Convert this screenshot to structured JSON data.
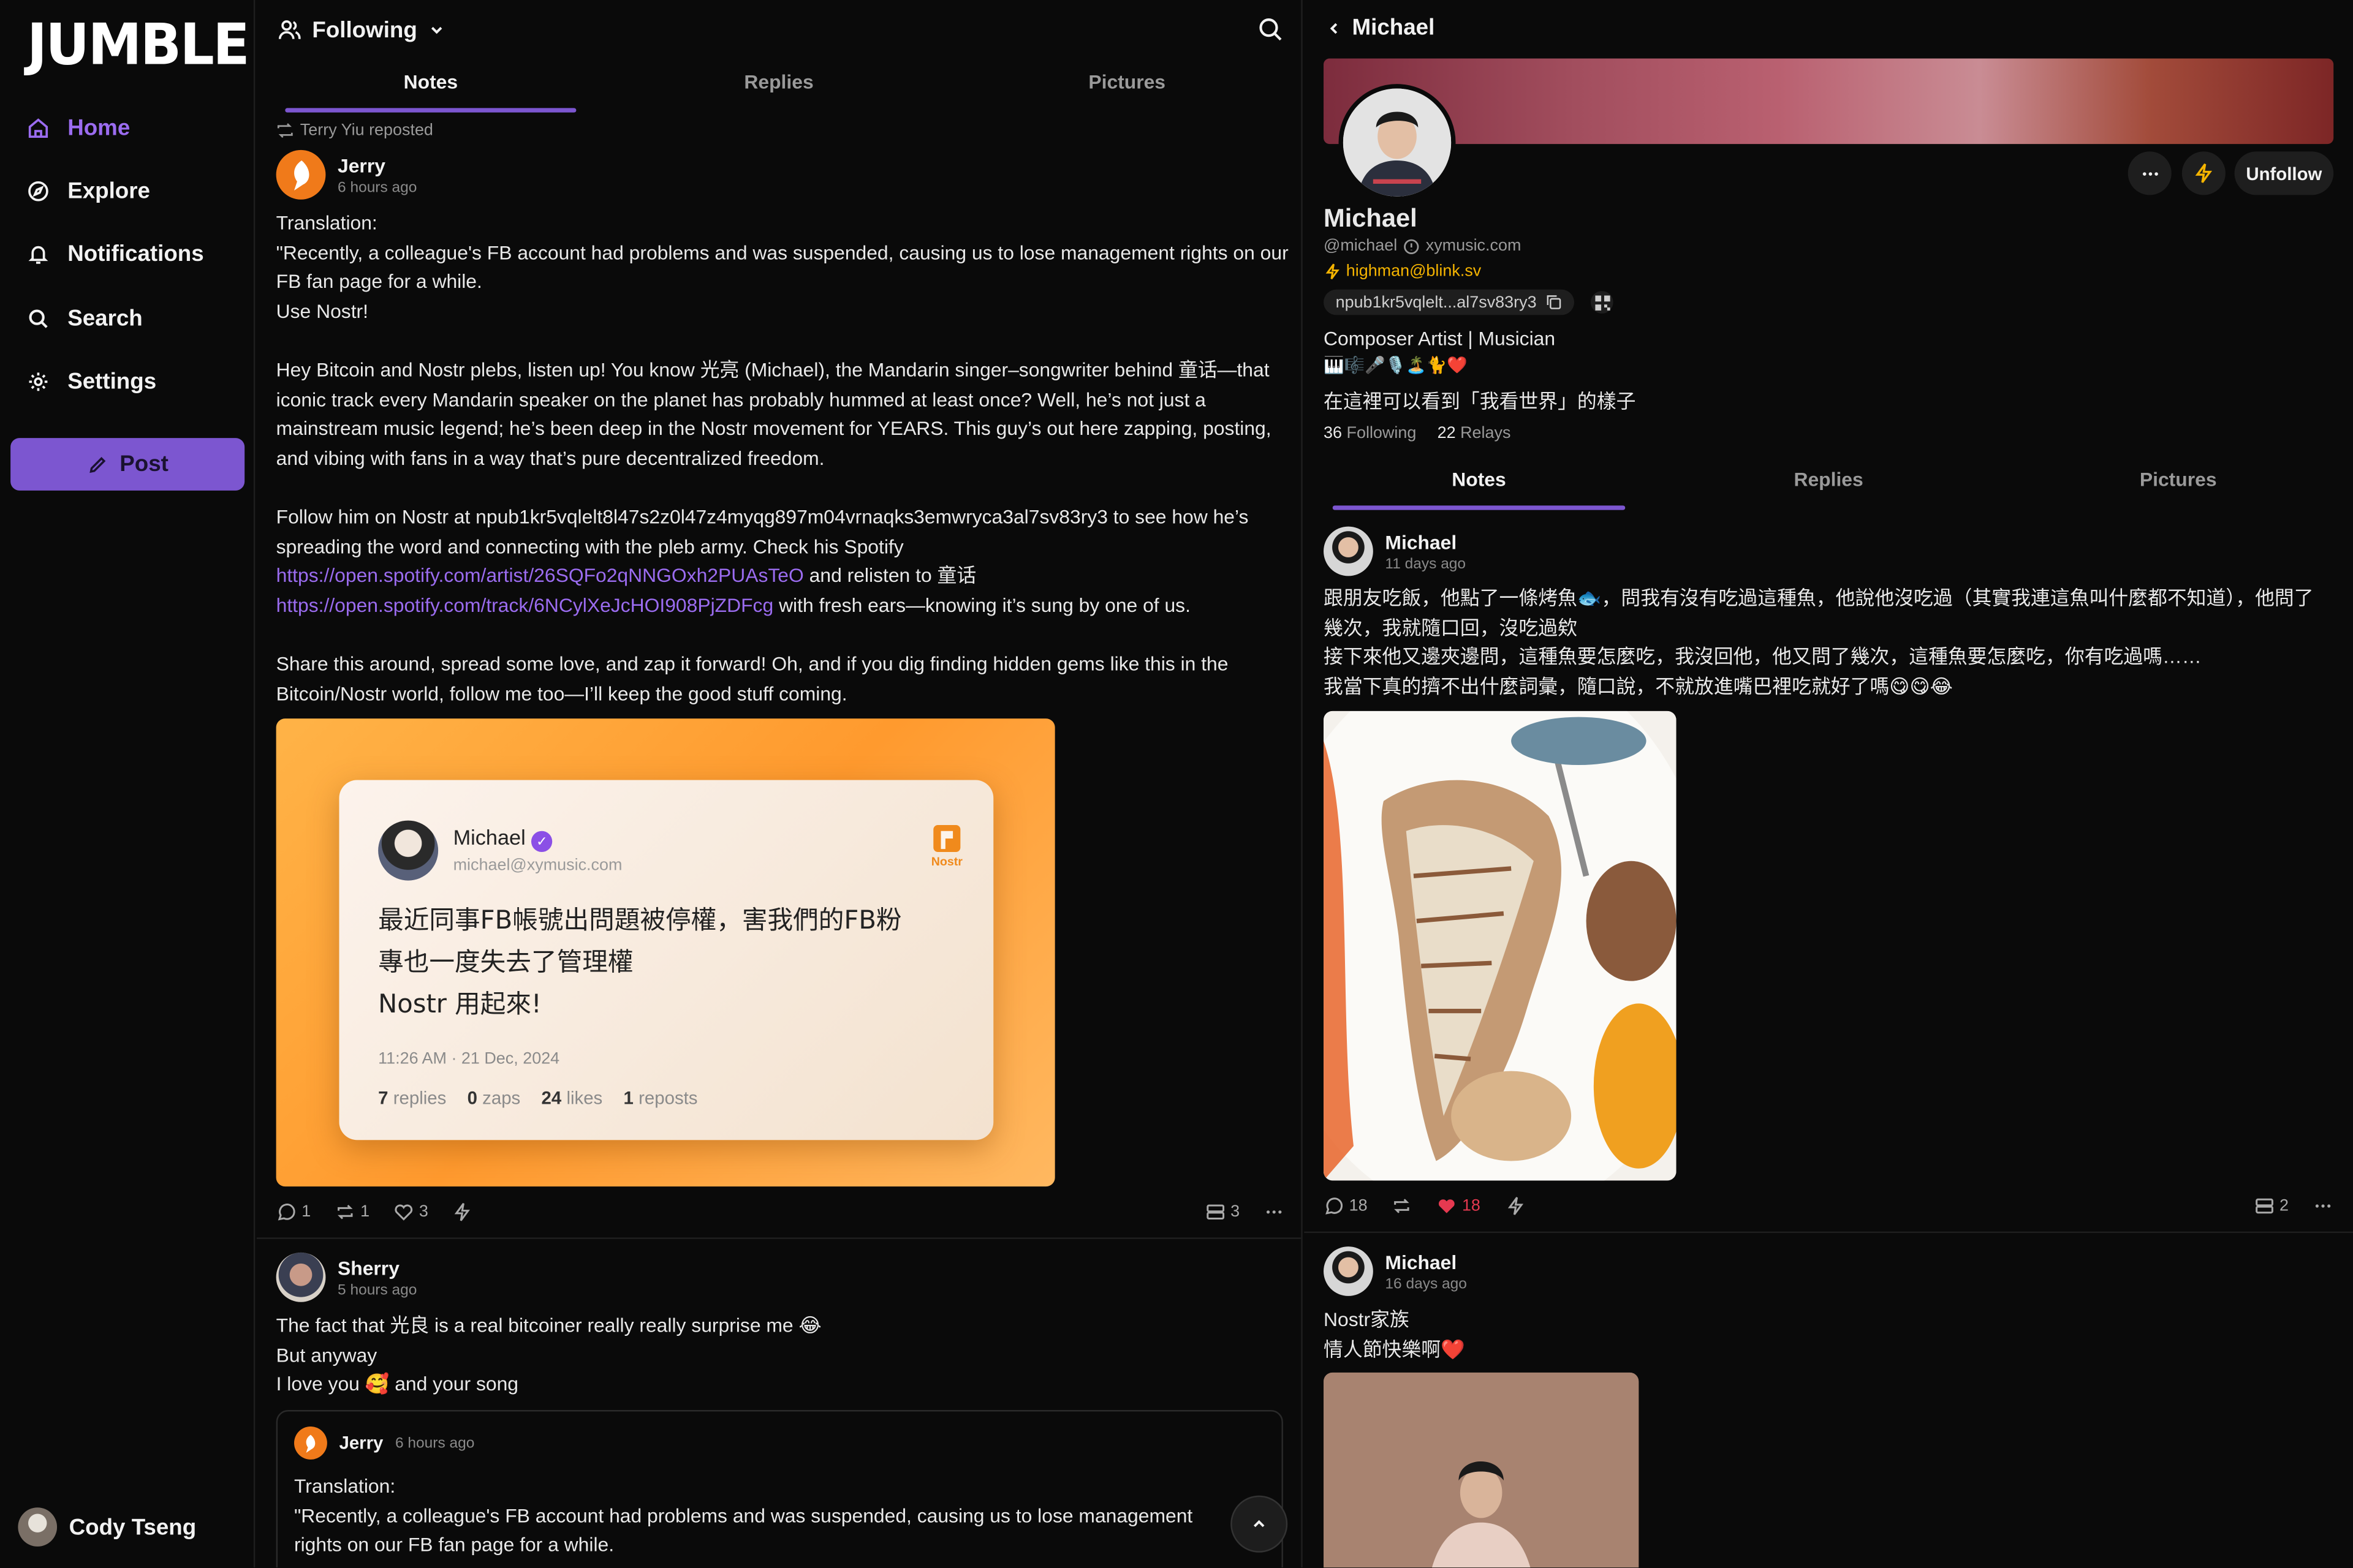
{
  "app": {
    "logo": "JUMBLE",
    "accent": "#7c56d0",
    "link_color": "#9b6cf0",
    "like_color": "#e63950",
    "zap_color": "#f5b400"
  },
  "sidebar": {
    "items": [
      {
        "label": "Home",
        "icon": "home-icon",
        "active": true
      },
      {
        "label": "Explore",
        "icon": "compass-icon"
      },
      {
        "label": "Notifications",
        "icon": "bell-icon"
      },
      {
        "label": "Search",
        "icon": "search-icon"
      },
      {
        "label": "Settings",
        "icon": "gear-icon"
      }
    ],
    "post_label": "Post",
    "user_name": "Cody Tseng"
  },
  "feed": {
    "title": "Following",
    "tabs": [
      "Notes",
      "Replies",
      "Pictures"
    ],
    "active_tab": "Notes",
    "note1": {
      "repost_label": "Terry Yiu reposted",
      "author": "Jerry",
      "ago": "6 hours ago",
      "paragraphs": [
        "Translation:",
        "\"Recently, a colleague's FB account had problems and was suspended, causing us to lose management rights on our FB fan page for a while.",
        "Use Nostr!",
        "Hey Bitcoin and Nostr plebs, listen up! You know 光亮 (Michael), the Mandarin singer–songwriter behind 童话—that iconic track every Mandarin speaker on the planet has probably hummed at least once? Well, he’s not just a mainstream music legend; he’s been deep in the Nostr movement for YEARS. This guy’s out here zapping, posting, and vibing with fans in a way that’s pure decentralized freedom.",
        "Follow him on Nostr at npub1kr5vqlelt8l47s2z0l47z4myqg897m04vrnaqks3emwryca3al7sv83ry3 to see how he’s spreading the word and connecting with the pleb army. Check his Spotify",
        "and relisten to 童话",
        "with fresh ears—knowing it’s sung by one of us.",
        "Share this around, spread some love, and zap it forward! Oh, and if you dig finding hidden gems like this in the Bitcoin/Nostr world, follow me too—I’ll keep the good stuff coming."
      ],
      "link1": "https://open.spotify.com/artist/26SQFo2qNNGOxh2PUAsTeO",
      "link2": "https://open.spotify.com/track/6NCylXeJcHOI908PjZDFcg",
      "image_card": {
        "name": "Michael",
        "handle": "michael@xymusic.com",
        "badge": "Nostr",
        "text_line1": "最近同事FB帳號出問題被停權，害我們的FB粉",
        "text_line2": "專也一度失去了管理權",
        "text_line3": "Nostr 用起來!",
        "time": "11:26 AM · 21 Dec, 2024",
        "replies_n": "7",
        "replies_l": "replies",
        "zaps_n": "0",
        "zaps_l": "zaps",
        "likes_n": "24",
        "likes_l": "likes",
        "reposts_n": "1",
        "reposts_l": "reposts"
      },
      "stats": {
        "replies": "1",
        "reposts": "1",
        "likes": "3",
        "relays": "3"
      }
    },
    "note2": {
      "author": "Sherry",
      "ago": "5 hours ago",
      "line1": "The fact that 光良 is a real bitcoiner really really surprise me 😂",
      "line2": "But anyway",
      "line3": "I love you 🥰 and your song",
      "quote": {
        "author": "Jerry",
        "ago": "6 hours ago",
        "line1": "Translation:",
        "line2": "\"Recently, a colleague's FB account had problems and was suspended, causing us to lose management",
        "line3": "rights on our FB fan page for a while."
      }
    }
  },
  "profile": {
    "back_title": "Michael",
    "name": "Michael",
    "handle": "@michael",
    "nip05": "xymusic.com",
    "lightning": "highman@blink.sv",
    "npub": "npub1kr5vqlelt...al7sv83ry3",
    "bio_line1": "Composer Artist | Musician",
    "bio_line2": "🎹🎼🎤🎙️🏝️🐈❤️",
    "bio_line3": "在這裡可以看到「我看世界」的樣子",
    "following_count": "36",
    "following_label": "Following",
    "relays_count": "22",
    "relays_label": "Relays",
    "unfollow_label": "Unfollow",
    "tabs": [
      "Notes",
      "Replies",
      "Pictures"
    ],
    "post1": {
      "author": "Michael",
      "ago": "11 days ago",
      "line1": "跟朋友吃飯，他點了一條烤魚🐟，問我有沒有吃過這種魚，他說他沒吃過（其實我連這魚叫什麼都不知道），他問了",
      "line2": "幾次，我就隨口回，沒吃過欸",
      "line3": "接下來他又邊夾邊問，這種魚要怎麼吃，我沒回他，他又問了幾次，這種魚要怎麼吃，你有吃過嗎……",
      "line4": "我當下真的擠不出什麼詞彙，隨口說，不就放進嘴巴裡吃就好了嗎😋😋😂",
      "stats": {
        "replies": "18",
        "likes": "18",
        "relays": "2"
      }
    },
    "post2": {
      "author": "Michael",
      "ago": "16 days ago",
      "line1": "Nostr家族",
      "line2": "情人節快樂啊❤️"
    }
  }
}
